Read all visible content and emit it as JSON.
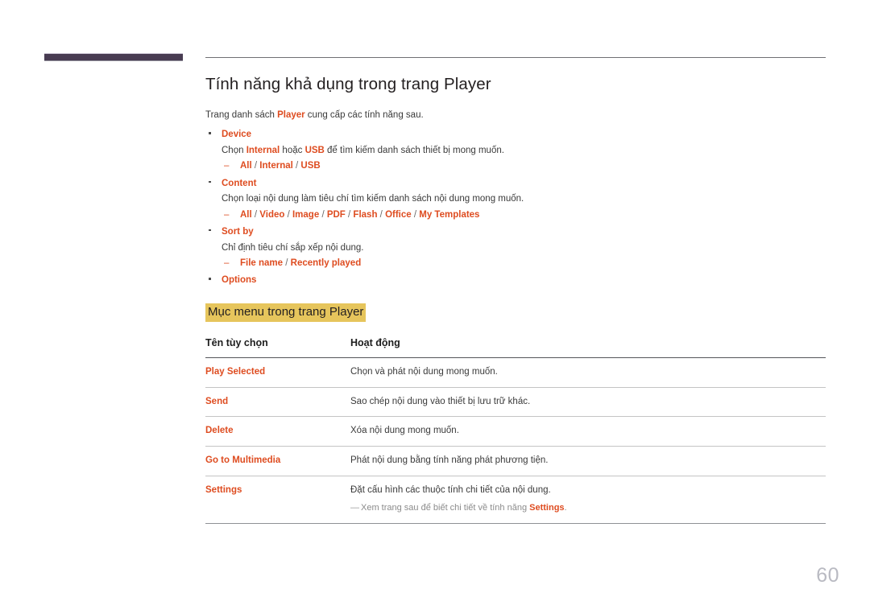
{
  "page": {
    "number": "60",
    "accent_orange": "#de4c20",
    "highlight_yellow": "#e6c55c",
    "tab_purple": "#483c52"
  },
  "header": {
    "title": "Tính năng khả dụng trong trang Player"
  },
  "intro": {
    "before": "Trang danh sách ",
    "keyword": "Player",
    "after": " cung cấp các tính năng sau."
  },
  "features": [
    {
      "label": "Device",
      "desc_before": "Chọn ",
      "desc_kw1": "Internal",
      "desc_mid": " hoặc ",
      "desc_kw2": "USB",
      "desc_after": " để tìm kiếm danh sách thiết bị mong muốn.",
      "options": "All / Internal / USB"
    },
    {
      "label": "Content",
      "desc": "Chọn loại nội dung làm tiêu chí tìm kiếm danh sách nội dung mong muốn.",
      "options": "All / Video / Image / PDF / Flash / Office / My Templates"
    },
    {
      "label": "Sort by",
      "desc": "Chỉ định tiêu chí sắp xếp nội dung.",
      "options": "File name / Recently played"
    },
    {
      "label": "Options"
    }
  ],
  "section": {
    "heading": "Mục menu trong trang Player"
  },
  "table": {
    "columns": [
      "Tên tùy chọn",
      "Hoạt động"
    ],
    "rows": [
      {
        "name": "Play Selected",
        "action": "Chọn và phát nội dung mong muốn."
      },
      {
        "name": "Send",
        "action": "Sao chép nội dung vào thiết bị lưu trữ khác."
      },
      {
        "name": "Delete",
        "action": "Xóa nội dung mong muốn."
      },
      {
        "name": "Go to Multimedia",
        "action": "Phát nội dung bằng tính năng phát phương tiện."
      },
      {
        "name": "Settings",
        "action": "Đặt cấu hình các thuộc tính chi tiết của nội dung.",
        "note_dash": "—",
        "note_before": "Xem trang sau để biết chi tiết về tính năng ",
        "note_kw": "Settings",
        "note_after": "."
      }
    ]
  }
}
